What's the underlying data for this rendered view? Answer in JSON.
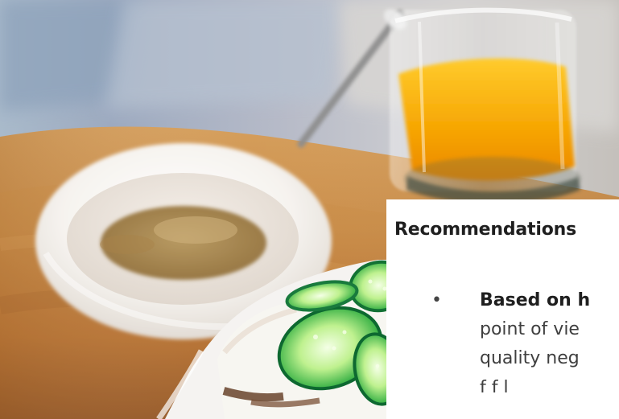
{
  "photo": {
    "subject": "breakfast-photo"
  },
  "article": {
    "section_title": "Recommendations",
    "recommendations": [
      {
        "bullet": "•",
        "lead": "Based on h",
        "line_1": "point of vie",
        "line_2": "quality neg",
        "line_3": "f   f   l"
      }
    ]
  },
  "colors": {
    "page_background": "#ffffff",
    "heading_text": "#1f1f1f",
    "body_text": "#3f3f3f"
  }
}
